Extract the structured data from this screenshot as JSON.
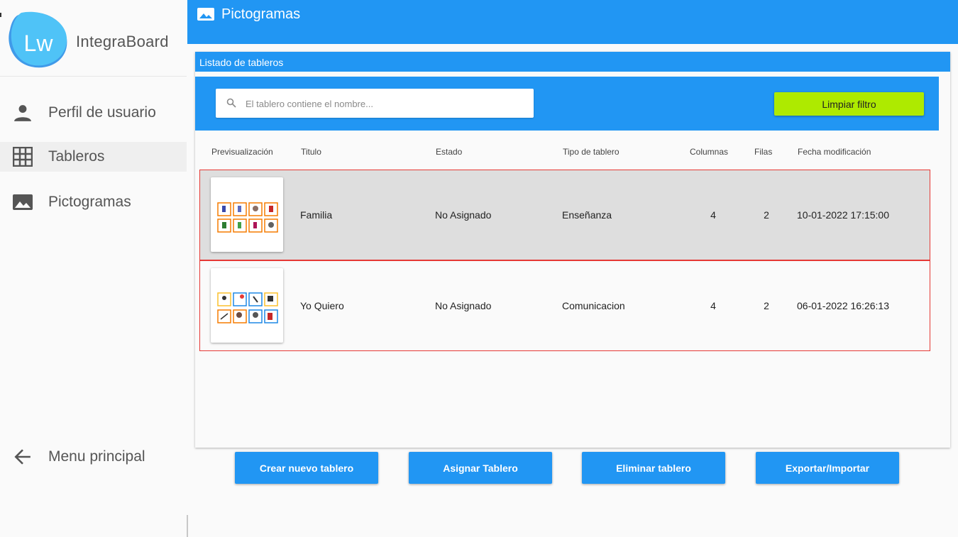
{
  "brand": {
    "name": "IntegraBoard",
    "logo_text": "Lw"
  },
  "sidebar": {
    "items": [
      {
        "label": "Perfil de usuario",
        "icon": "person-icon"
      },
      {
        "label": "Tableros",
        "icon": "grid-icon"
      },
      {
        "label": "Pictogramas",
        "icon": "image-icon"
      }
    ],
    "back": {
      "label": "Menu principal",
      "icon": "arrow-left-icon"
    }
  },
  "topbar": {
    "title": "Pictogramas",
    "icon": "image-icon"
  },
  "card": {
    "header": "Listado de tableros",
    "search_placeholder": "El tablero contiene el nombre...",
    "clear_button": "Limpiar filtro"
  },
  "table": {
    "columns": [
      "Previsualización",
      "Titulo",
      "Estado",
      "Tipo de tablero",
      "Columnas",
      "Filas",
      "Fecha modificación"
    ],
    "rows": [
      {
        "title": "Familia",
        "estado": "No Asignado",
        "tipo": "Enseñanza",
        "columnas": "4",
        "filas": "2",
        "fecha": "10-01-2022 17:15:00"
      },
      {
        "title": "Yo Quiero",
        "estado": "No Asignado",
        "tipo": "Comunicacion",
        "columnas": "4",
        "filas": "2",
        "fecha": "06-01-2022 16:26:13"
      }
    ]
  },
  "actions": {
    "create": "Crear nuevo tablero",
    "assign": "Asignar Tablero",
    "delete": "Eliminar tablero",
    "export": "Exportar/Importar"
  },
  "colors": {
    "primary": "#2196f3",
    "accent_green": "#aeea00",
    "row_border": "#e53935",
    "selected_row": "#dedede"
  }
}
